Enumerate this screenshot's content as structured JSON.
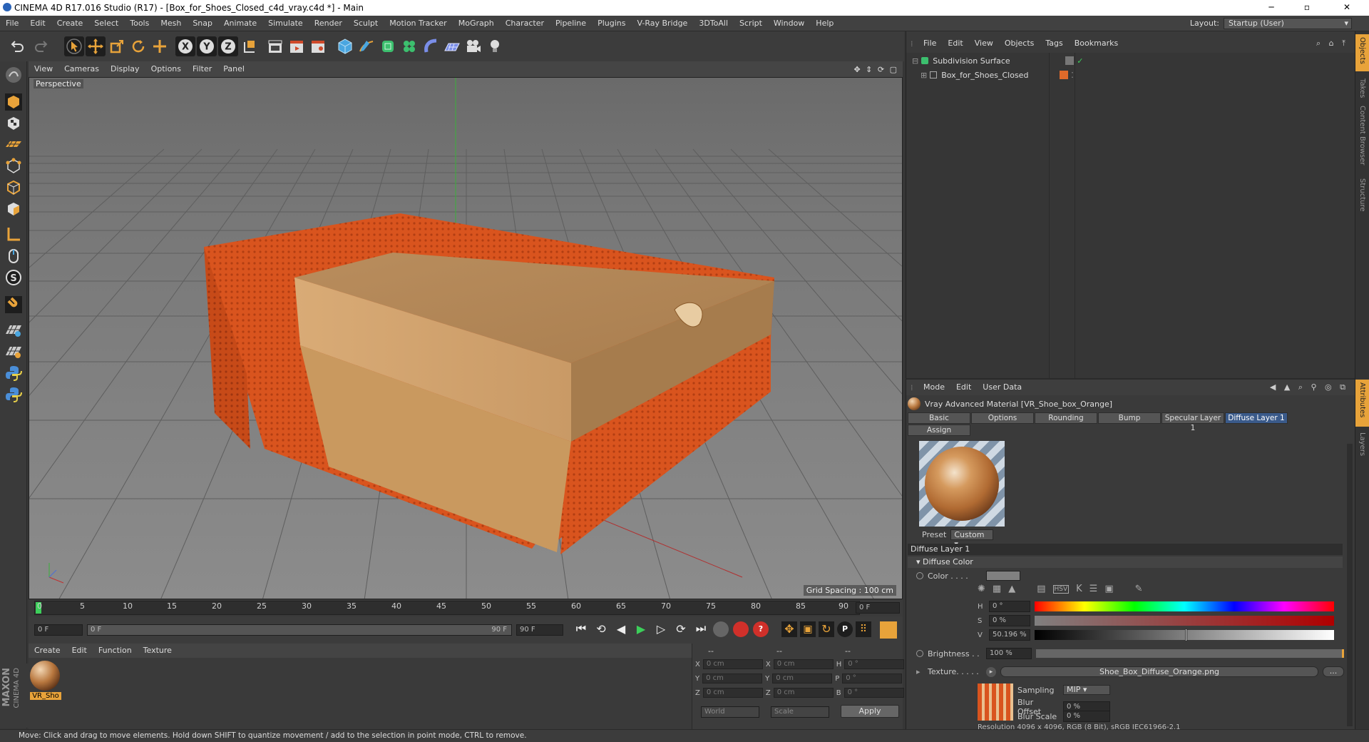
{
  "window": {
    "title": "CINEMA 4D R17.016 Studio (R17) - [Box_for_Shoes_Closed_c4d_vray.c4d *] - Main",
    "minimize": "─",
    "maximize": "▫",
    "close": "✕"
  },
  "menubar": {
    "items": [
      "File",
      "Edit",
      "Create",
      "Select",
      "Tools",
      "Mesh",
      "Snap",
      "Animate",
      "Simulate",
      "Render",
      "Sculpt",
      "Motion Tracker",
      "MoGraph",
      "Character",
      "Pipeline",
      "Plugins",
      "V-Ray Bridge",
      "3DToAll",
      "Script",
      "Window",
      "Help"
    ],
    "layout_label": "Layout:",
    "layout_value": "Startup (User)"
  },
  "viewport": {
    "menu": [
      "View",
      "Cameras",
      "Display",
      "Options",
      "Filter",
      "Panel"
    ],
    "label": "Perspective",
    "grid_spacing": "Grid Spacing : 100 cm"
  },
  "timeline": {
    "ticks": [
      "0",
      "5",
      "10",
      "15",
      "20",
      "25",
      "30",
      "35",
      "40",
      "45",
      "50",
      "55",
      "60",
      "65",
      "70",
      "75",
      "80",
      "85",
      "90"
    ],
    "current_frame": "0 F",
    "start": "0 F",
    "range_start": "0 F",
    "range_end": "90 F",
    "end": "90 F"
  },
  "materials": {
    "menu": [
      "Create",
      "Edit",
      "Function",
      "Texture"
    ],
    "items": [
      {
        "name": "VR_Sho"
      }
    ]
  },
  "coordinates": {
    "headers": [
      "--",
      "--",
      "--"
    ],
    "pos": [
      {
        "axis": "X",
        "value": "0 cm"
      },
      {
        "axis": "Y",
        "value": "0 cm"
      },
      {
        "axis": "Z",
        "value": "0 cm"
      }
    ],
    "size": [
      {
        "axis": "X",
        "value": "0 cm"
      },
      {
        "axis": "Y",
        "value": "0 cm"
      },
      {
        "axis": "Z",
        "value": "0 cm"
      }
    ],
    "rot": [
      {
        "axis": "H",
        "value": "0 °"
      },
      {
        "axis": "P",
        "value": "0 °"
      },
      {
        "axis": "B",
        "value": "0 °"
      }
    ],
    "world": "World",
    "scale": "Scale",
    "apply": "Apply"
  },
  "status": {
    "text": "Move: Click and drag to move elements. Hold down SHIFT to quantize movement / add to the selection in point mode, CTRL to remove."
  },
  "brand": {
    "line1": "MAXON",
    "line2": "CINEMA 4D"
  },
  "objects": {
    "menu": [
      "File",
      "Edit",
      "View",
      "Objects",
      "Tags",
      "Bookmarks"
    ],
    "items": [
      {
        "name": "Subdivision Surface"
      },
      {
        "name": "Box_for_Shoes_Closed"
      }
    ]
  },
  "attributes": {
    "menu": [
      "Mode",
      "Edit",
      "User Data"
    ],
    "material_title": "Vray Advanced Material [VR_Shoe_box_Orange]",
    "tabs": [
      "Basic",
      "Options",
      "Rounding",
      "Bump",
      "Specular Layer 1",
      "Diffuse Layer 1"
    ],
    "assign": "Assign",
    "preset_label": "Preset",
    "preset_value": "Custom",
    "section": "Diffuse Layer 1",
    "subsection": "Diffuse Color",
    "color_label": "Color . . . .",
    "h_label": "H",
    "h_value": "0 °",
    "s_label": "S",
    "s_value": "0 %",
    "v_label": "V",
    "v_value": "50.196 %",
    "v_level": 0.502,
    "brightness_label": "Brightness . .",
    "brightness_value": "100 %",
    "texture_label": "Texture. . . . .",
    "texture_file": "Shoe_Box_Diffuse_Orange.png",
    "texture_more": "...",
    "sampling_label": "Sampling",
    "sampling_value": "MIP",
    "blur_offset_label": "Blur Offset",
    "blur_offset_value": "0 %",
    "blur_scale_label": "Blur Scale",
    "blur_scale_value": "0 %",
    "resolution": "Resolution 4096 x 4096, RGB (8 Bit), sRGB IEC61966-2.1"
  },
  "side_tabs": [
    "Objects",
    "Takes",
    "Content Browser",
    "Structure",
    "Attributes",
    "Layers"
  ]
}
